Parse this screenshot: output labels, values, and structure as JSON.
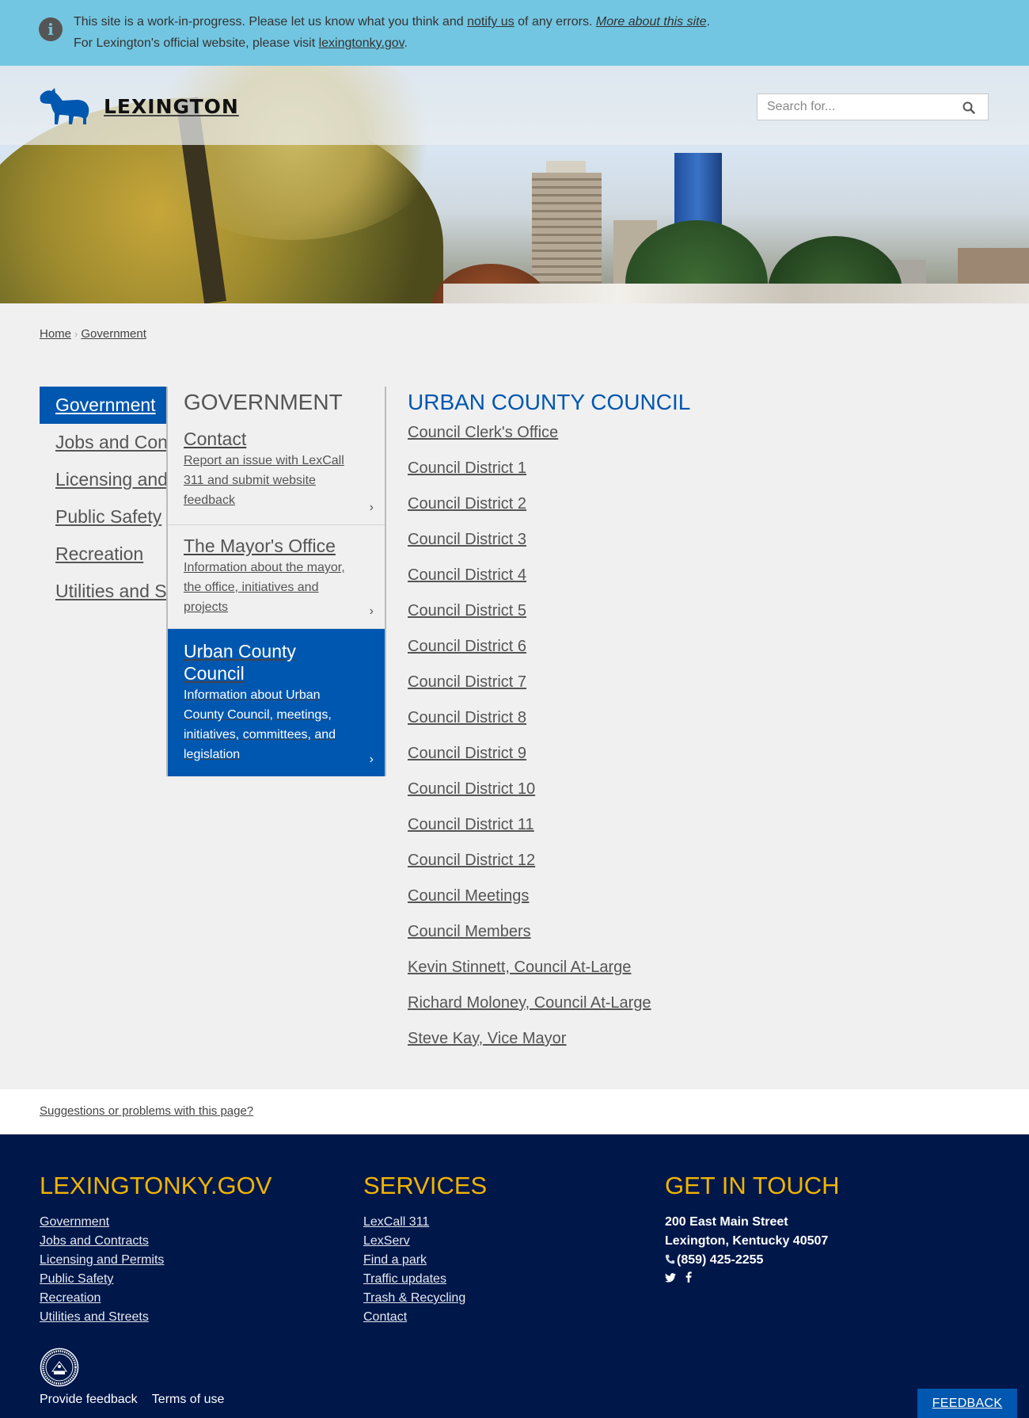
{
  "alert": {
    "line1_pre": "This site is a work-in-progress. Please let us know what you think and ",
    "line1_link": "notify us",
    "line1_mid": " of any errors. ",
    "line1_link2": "More about this site",
    "line1_end": ".",
    "line2_pre": "For Lexington's official website, please visit ",
    "line2_link": "lexingtonky.gov",
    "line2_end": "."
  },
  "header": {
    "logo_text": "LEXINGTON",
    "search_placeholder": "Search for..."
  },
  "breadcrumb": {
    "home": "Home",
    "current": "Government"
  },
  "leftnav": {
    "items": [
      {
        "label": "Government"
      },
      {
        "label": "Jobs and Contracts"
      },
      {
        "label": "Licensing and Permits"
      },
      {
        "label": "Public Safety"
      },
      {
        "label": "Recreation"
      },
      {
        "label": "Utilities and Streets"
      }
    ]
  },
  "midpanel": {
    "heading": "GOVERNMENT",
    "cards": [
      {
        "title": "Contact",
        "desc": "Report an issue with LexCall 311 and submit website feedback"
      },
      {
        "title": "The Mayor's Office",
        "desc": "Information about the mayor, the office, initiatives and projects"
      },
      {
        "title": "Urban County Council",
        "desc": "Information about Urban County Council, meetings, initiatives, committees, and legislation"
      }
    ]
  },
  "council": {
    "heading": "URBAN COUNTY COUNCIL",
    "links": [
      "Council Clerk's Office",
      "Council District 1",
      "Council District 2",
      "Council District 3",
      "Council District 4",
      "Council District 5",
      "Council District 6",
      "Council District 7",
      "Council District 8",
      "Council District 9",
      "Council District 10",
      "Council District 11",
      "Council District 12",
      "Council Meetings",
      "Council Members",
      "Kevin Stinnett, Council At-Large",
      "Richard Moloney, Council At-Large",
      "Steve Kay, Vice Mayor"
    ]
  },
  "suggest": {
    "label": "Suggestions or problems with this page?"
  },
  "footer": {
    "col1": {
      "heading": "LEXINGTONKY.GOV",
      "links": [
        "Government",
        "Jobs and Contracts",
        "Licensing and Permits",
        "Public Safety",
        "Recreation",
        "Utilities and Streets"
      ]
    },
    "col2": {
      "heading": "SERVICES",
      "links": [
        "LexCall 311",
        "LexServ",
        "Find a park",
        "Traffic updates",
        "Trash & Recycling",
        "Contact"
      ]
    },
    "col3": {
      "heading": "GET IN TOUCH",
      "address1": "200 East Main Street",
      "address2": "Lexington, Kentucky 40507",
      "phone": "(859) 425-2255"
    },
    "bottom": {
      "feedback": "Provide feedback",
      "terms": "Terms of use"
    }
  },
  "feedback_button": "FEEDBACK",
  "colors": {
    "alert_bg": "#73c6e1",
    "brand_blue": "#0057b0",
    "footer_bg": "#00174a",
    "footer_heading": "#f0b400"
  }
}
